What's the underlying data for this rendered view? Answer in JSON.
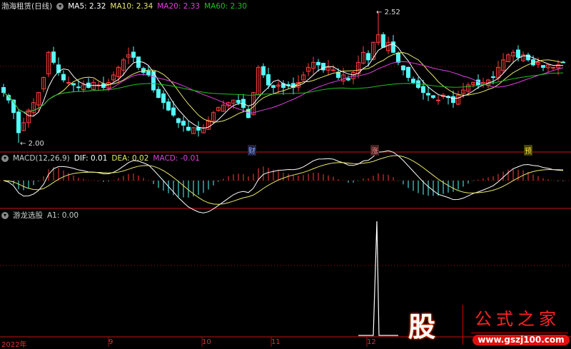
{
  "main_header": {
    "title": "渤海租赁(日线)",
    "ma5": "MA5: 2.32",
    "ma10": "MA10: 2.34",
    "ma20": "MA20: 2.33",
    "ma60": "MA60: 2.30"
  },
  "macd_header": {
    "name": "MACD(12,26,9)",
    "dif": "DIF: 0.01",
    "dea": "DEA: 0.02",
    "macd": "MACD: -0.01"
  },
  "ind_header": {
    "name": "游龙选股",
    "a1": "A1: 0.00"
  },
  "price_labels": {
    "low": "2.00",
    "high": "2.52"
  },
  "markers": [
    "财",
    "涨",
    "预"
  ],
  "x_axis": [
    "2022年",
    "9",
    "10",
    "11",
    "12"
  ],
  "watermark": {
    "glyph": "股",
    "name": "公式之家",
    "url": "www.gszj100.com"
  },
  "colors": {
    "up": "#ff3c3c",
    "down": "#54ffff",
    "ma5": "#ffffff",
    "ma10": "#e8e86a",
    "ma20": "#e040e0",
    "ma60": "#20c020",
    "grid": "#a01010"
  },
  "chart_data": {
    "type": "candlestick",
    "ylim": [
      2.0,
      2.52
    ],
    "closes": [
      2.2,
      2.17,
      2.12,
      2.04,
      2.08,
      2.13,
      2.16,
      2.2,
      2.26,
      2.36,
      2.32,
      2.28,
      2.25,
      2.24,
      2.23,
      2.22,
      2.23,
      2.22,
      2.24,
      2.23,
      2.22,
      2.24,
      2.27,
      2.3,
      2.33,
      2.35,
      2.34,
      2.3,
      2.28,
      2.27,
      2.21,
      2.18,
      2.16,
      2.13,
      2.11,
      2.08,
      2.07,
      2.05,
      2.06,
      2.05,
      2.06,
      2.09,
      2.12,
      2.14,
      2.15,
      2.16,
      2.17,
      2.16,
      2.14,
      2.1,
      2.2,
      2.3,
      2.27,
      2.23,
      2.22,
      2.23,
      2.22,
      2.23,
      2.22,
      2.24,
      2.27,
      2.3,
      2.32,
      2.31,
      2.29,
      2.3,
      2.29,
      2.26,
      2.27,
      2.25,
      2.28,
      2.32,
      2.36,
      2.33,
      2.4,
      2.43,
      2.38,
      2.4,
      2.36,
      2.32,
      2.29,
      2.26,
      2.24,
      2.22,
      2.2,
      2.19,
      2.18,
      2.17,
      2.19,
      2.18,
      2.16,
      2.19,
      2.21,
      2.23,
      2.24,
      2.23,
      2.24,
      2.25,
      2.26,
      2.3,
      2.33,
      2.35,
      2.36,
      2.34,
      2.35,
      2.33,
      2.31,
      2.32,
      2.3,
      2.31,
      2.3,
      2.31,
      2.32
    ],
    "signal_index": 75
  }
}
